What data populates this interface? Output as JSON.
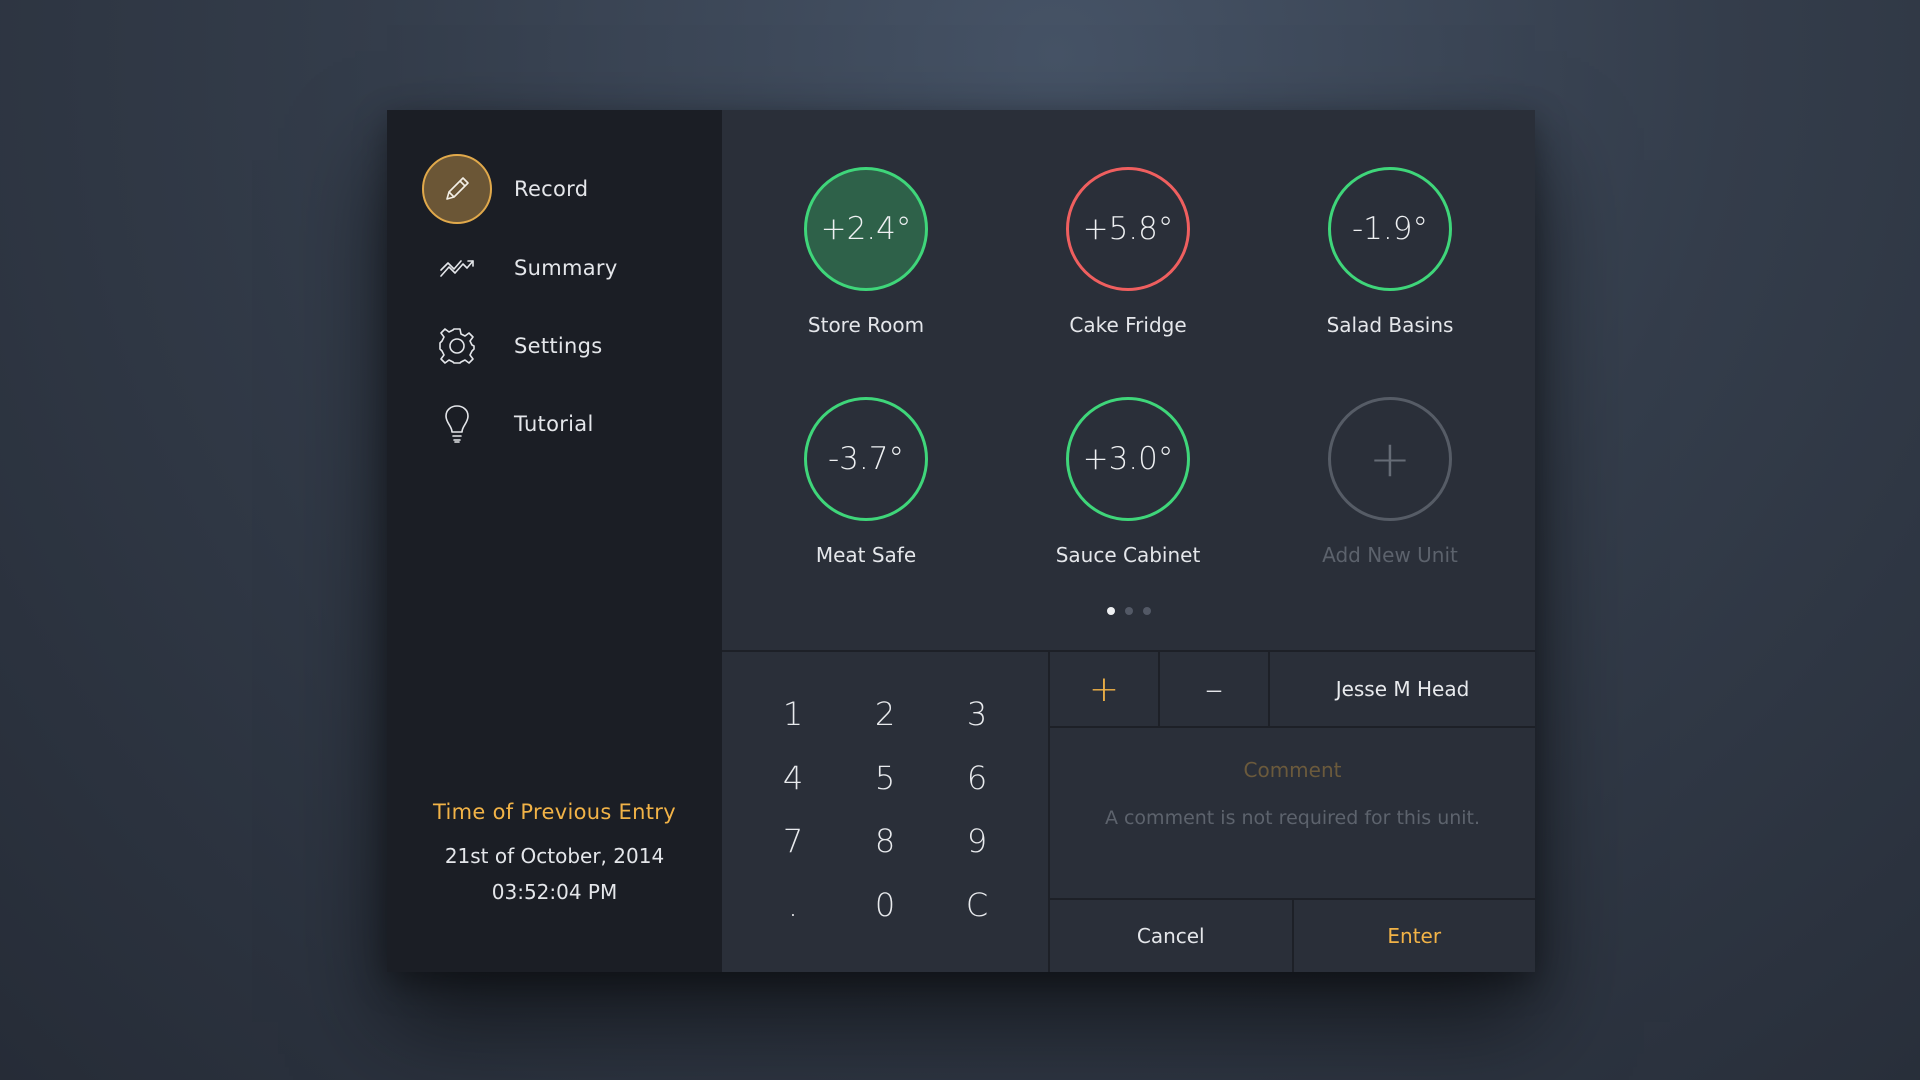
{
  "sidebar": {
    "nav": [
      {
        "label": "Record",
        "icon": "pencil-icon",
        "active": true
      },
      {
        "label": "Summary",
        "icon": "trend-chart-icon",
        "active": false
      },
      {
        "label": "Settings",
        "icon": "gear-icon",
        "active": false
      },
      {
        "label": "Tutorial",
        "icon": "lightbulb-icon",
        "active": false
      }
    ],
    "previous_entry": {
      "title": "Time of Previous Entry",
      "date": "21st of October, 2014",
      "time": "03:52:04 PM"
    }
  },
  "units": [
    {
      "name": "Store Room",
      "temp": "+2.4°",
      "status": "ok-selected"
    },
    {
      "name": "Cake Fridge",
      "temp": "+5.8°",
      "status": "warning"
    },
    {
      "name": "Salad Basins",
      "temp": "-1.9°",
      "status": "ok"
    },
    {
      "name": "Meat Safe",
      "temp": "-3.7°",
      "status": "ok"
    },
    {
      "name": "Sauce Cabinet",
      "temp": "+3.0°",
      "status": "ok"
    }
  ],
  "add_unit": {
    "label": "Add New Unit",
    "symbol": "+"
  },
  "pager": {
    "pages": 3,
    "current": 1
  },
  "keypad": {
    "keys": [
      "1",
      "2",
      "3",
      "4",
      "5",
      "6",
      "7",
      "8",
      "9",
      ".",
      "0",
      "C"
    ]
  },
  "entry": {
    "plus": "+",
    "minus": "–",
    "user": "Jesse M Head",
    "comment_title": "Comment",
    "comment_note": "A comment is not required for this unit.",
    "cancel": "Cancel",
    "enter": "Enter"
  },
  "colors": {
    "accent": "#f2b347",
    "ok": "#3fd67a",
    "warning": "#ef5f5f",
    "sidebar_bg": "#1b1e25",
    "main_bg": "#2a2f39"
  }
}
